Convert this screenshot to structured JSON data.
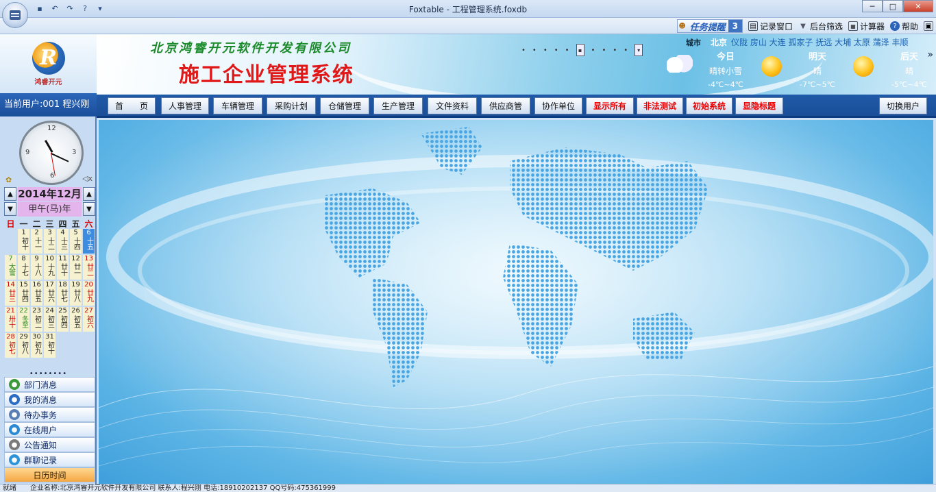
{
  "window": {
    "title": "Foxtable - 工程管理系统.foxdb"
  },
  "toolbar": {
    "task_remind_label": "任务提醒",
    "task_remind_count": "3",
    "items": [
      {
        "label": "记录窗口",
        "icon": "window-icon"
      },
      {
        "label": "后台筛选",
        "icon": "filter-icon"
      },
      {
        "label": "计算器",
        "icon": "calculator-icon"
      },
      {
        "label": "帮助",
        "icon": "help-icon"
      }
    ]
  },
  "sidebar": {
    "logo_text": "鸿睿开元",
    "current_user": "当前用户:001 程兴刚",
    "calendar": {
      "year_month": "2014年12月",
      "ganzhi": "甲午(马)年",
      "weekdays": [
        "日",
        "一",
        "二",
        "三",
        "四",
        "五",
        "六"
      ],
      "cells": [
        {
          "d": "",
          "l": ""
        },
        {
          "d": "1",
          "l": "初十"
        },
        {
          "d": "2",
          "l": "十一"
        },
        {
          "d": "3",
          "l": "十二"
        },
        {
          "d": "4",
          "l": "十三"
        },
        {
          "d": "5",
          "l": "十四"
        },
        {
          "d": "6",
          "l": "十五"
        },
        {
          "d": "7",
          "l": "大雪"
        },
        {
          "d": "8",
          "l": "十七"
        },
        {
          "d": "9",
          "l": "十八"
        },
        {
          "d": "10",
          "l": "十九"
        },
        {
          "d": "11",
          "l": "廿十"
        },
        {
          "d": "12",
          "l": "廿一"
        },
        {
          "d": "13",
          "l": "廿二"
        },
        {
          "d": "14",
          "l": "廿三"
        },
        {
          "d": "15",
          "l": "廿四"
        },
        {
          "d": "16",
          "l": "廿五"
        },
        {
          "d": "17",
          "l": "廿六"
        },
        {
          "d": "18",
          "l": "廿七"
        },
        {
          "d": "19",
          "l": "廿八"
        },
        {
          "d": "20",
          "l": "廿九"
        },
        {
          "d": "21",
          "l": "卅十"
        },
        {
          "d": "22",
          "l": "冬至"
        },
        {
          "d": "23",
          "l": "初二"
        },
        {
          "d": "24",
          "l": "初三"
        },
        {
          "d": "25",
          "l": "初四"
        },
        {
          "d": "26",
          "l": "初五"
        },
        {
          "d": "27",
          "l": "初六"
        },
        {
          "d": "28",
          "l": "初七"
        },
        {
          "d": "29",
          "l": "初八"
        },
        {
          "d": "30",
          "l": "初九"
        },
        {
          "d": "31",
          "l": "初十"
        }
      ]
    },
    "dots": "••••••••",
    "menu": [
      {
        "label": "部门消息",
        "icon": "department-message-icon",
        "color": "#3a9a3a"
      },
      {
        "label": "我的消息",
        "icon": "my-message-icon",
        "color": "#2b6cc4"
      },
      {
        "label": "待办事务",
        "icon": "todo-icon",
        "color": "#5a7fb5"
      },
      {
        "label": "在线用户",
        "icon": "online-users-icon",
        "color": "#2a8ad4"
      },
      {
        "label": "公告通知",
        "icon": "announcement-icon",
        "color": "#7a7a7a"
      },
      {
        "label": "群聊记录",
        "icon": "group-chat-icon",
        "color": "#2f93d8"
      },
      {
        "label": "日历时间",
        "icon": "",
        "color": ""
      }
    ]
  },
  "header": {
    "company": "北京鸿睿开元软件开发有限公司",
    "system_name": "施工企业管理系统"
  },
  "weather": {
    "city_label": "城市",
    "city": "北京",
    "other_cities": "仪陇 房山 大连 孤家子 抚远 大埔 太原 蒲泽 丰顺",
    "days": [
      {
        "name": "今日",
        "condition": "晴转小雪",
        "temp": "-4℃~4℃",
        "icon": "snow-cloud-icon"
      },
      {
        "name": "明天",
        "condition": "晴",
        "temp": "-7℃~5℃",
        "icon": "sun-icon"
      },
      {
        "name": "后天",
        "condition": "晴",
        "temp": "-5℃~4℃",
        "icon": "sun-icon"
      }
    ],
    "more": "»"
  },
  "nav": {
    "items": [
      {
        "label": "首　　页",
        "red": false
      },
      {
        "label": "人事管理",
        "red": false
      },
      {
        "label": "车辆管理",
        "red": false
      },
      {
        "label": "采购计划",
        "red": false
      },
      {
        "label": "仓储管理",
        "red": false
      },
      {
        "label": "生产管理",
        "red": false
      },
      {
        "label": "文件资料",
        "red": false
      },
      {
        "label": "供应商管",
        "red": false
      },
      {
        "label": "协作单位",
        "red": false
      },
      {
        "label": "显示所有",
        "red": true
      },
      {
        "label": "非法测试",
        "red": true
      },
      {
        "label": "初始系统",
        "red": true
      },
      {
        "label": "显隐标题",
        "red": true
      }
    ],
    "switch_user": "切换用户"
  },
  "status": {
    "text": "就绪　　企业名称:北京鸿睿开元软件开发有限公司  联系人:程兴刚 电话:18910202137  QQ号码:475361999"
  }
}
